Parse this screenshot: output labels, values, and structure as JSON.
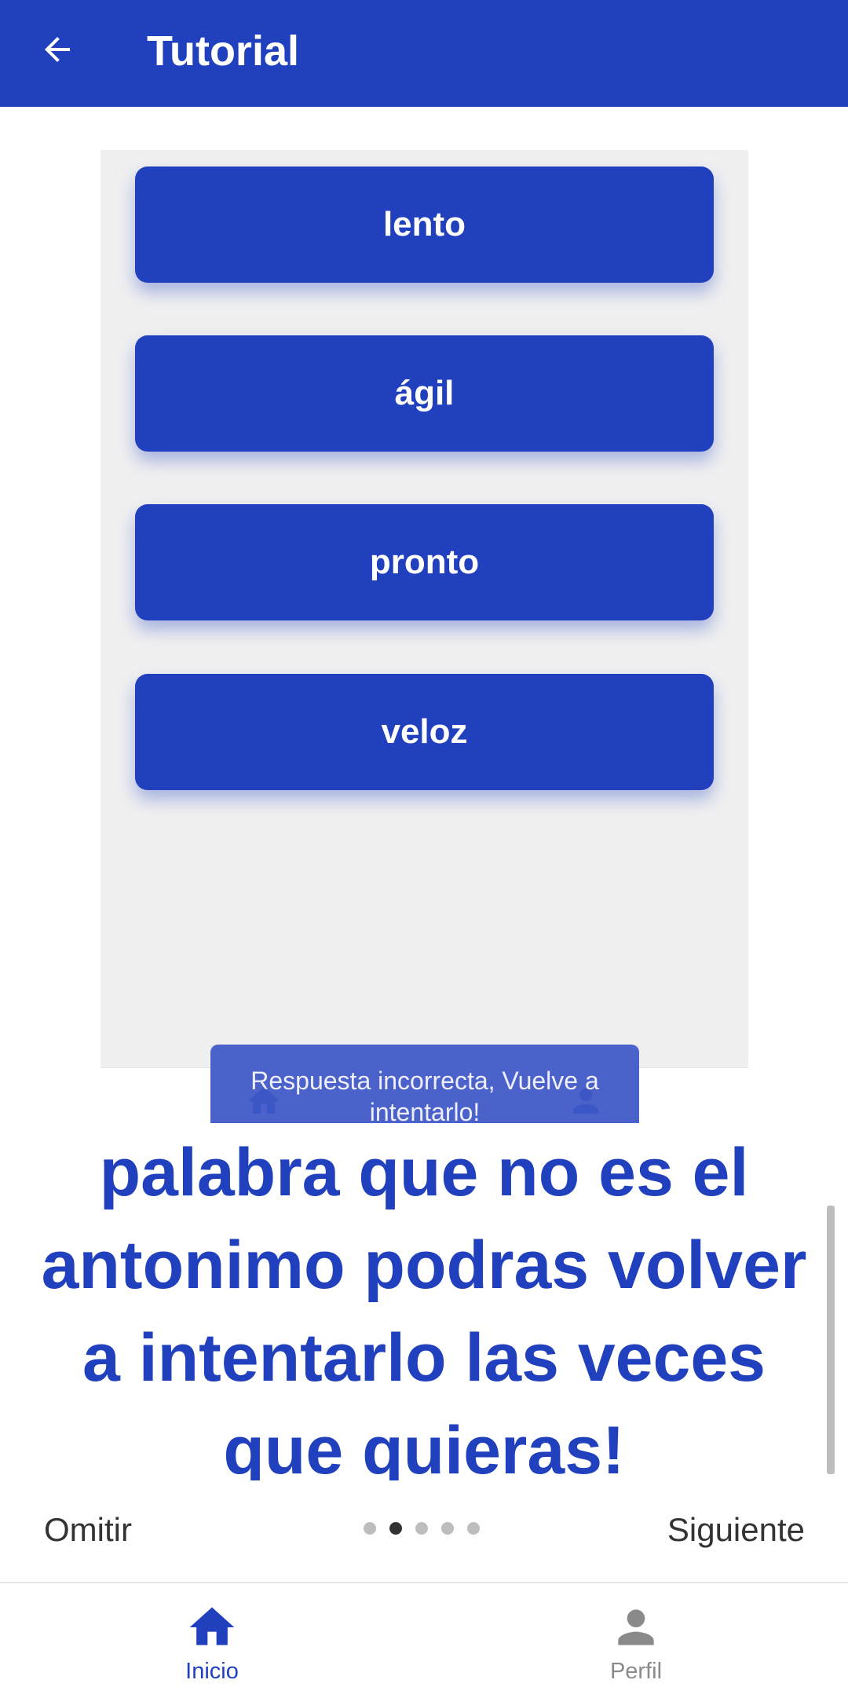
{
  "appbar": {
    "title": "Tutorial",
    "back_icon": "arrow-left-icon"
  },
  "options": [
    "lento",
    "ágil",
    "pronto",
    "veloz"
  ],
  "toast": {
    "message": "Respuesta incorrecta, Vuelve a intentarlo!"
  },
  "instruction": {
    "lines": [
      "palabra que no es el",
      "antonimo podras volver",
      "a intentarlo las veces",
      "que quieras!"
    ]
  },
  "pager": {
    "skip_label": "Omitir",
    "next_label": "Siguiente",
    "pages": 5,
    "current": 2
  },
  "nav": [
    {
      "label": "Inicio",
      "icon": "home-icon",
      "active": true
    },
    {
      "label": "Perfil",
      "icon": "person-icon",
      "active": false
    }
  ],
  "colors": {
    "primary": "#2040BE",
    "background": "#FFFFFF",
    "preview_bg": "#F0F0F1",
    "inactive": "#8A8A8A"
  }
}
